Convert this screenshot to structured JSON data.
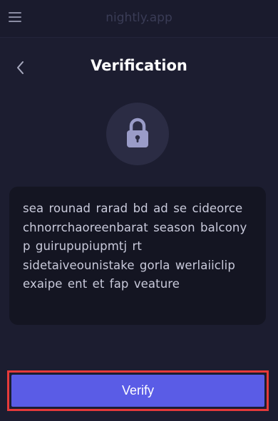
{
  "header": {
    "app_name": "nightly.app",
    "menu_icon": "hamburger-menu-icon"
  },
  "page": {
    "title": "Verification",
    "back_icon": "chevron-left-icon",
    "lock_icon": "padlock-icon"
  },
  "phrase": {
    "text": "sea rounad rarad bd ad se cideorce chnorrchaoreenbarat season balcony p guirupupiupmtj rt sidetaiveounistake gorla werlaiiclip exaipe ent et fap veature"
  },
  "colors": {
    "background": "#1c1d30",
    "phrase_box": "#141522",
    "accent": "#5a5ce6",
    "highlight_border": "#e53a3a"
  },
  "actions": {
    "verify_label": "Verify"
  }
}
